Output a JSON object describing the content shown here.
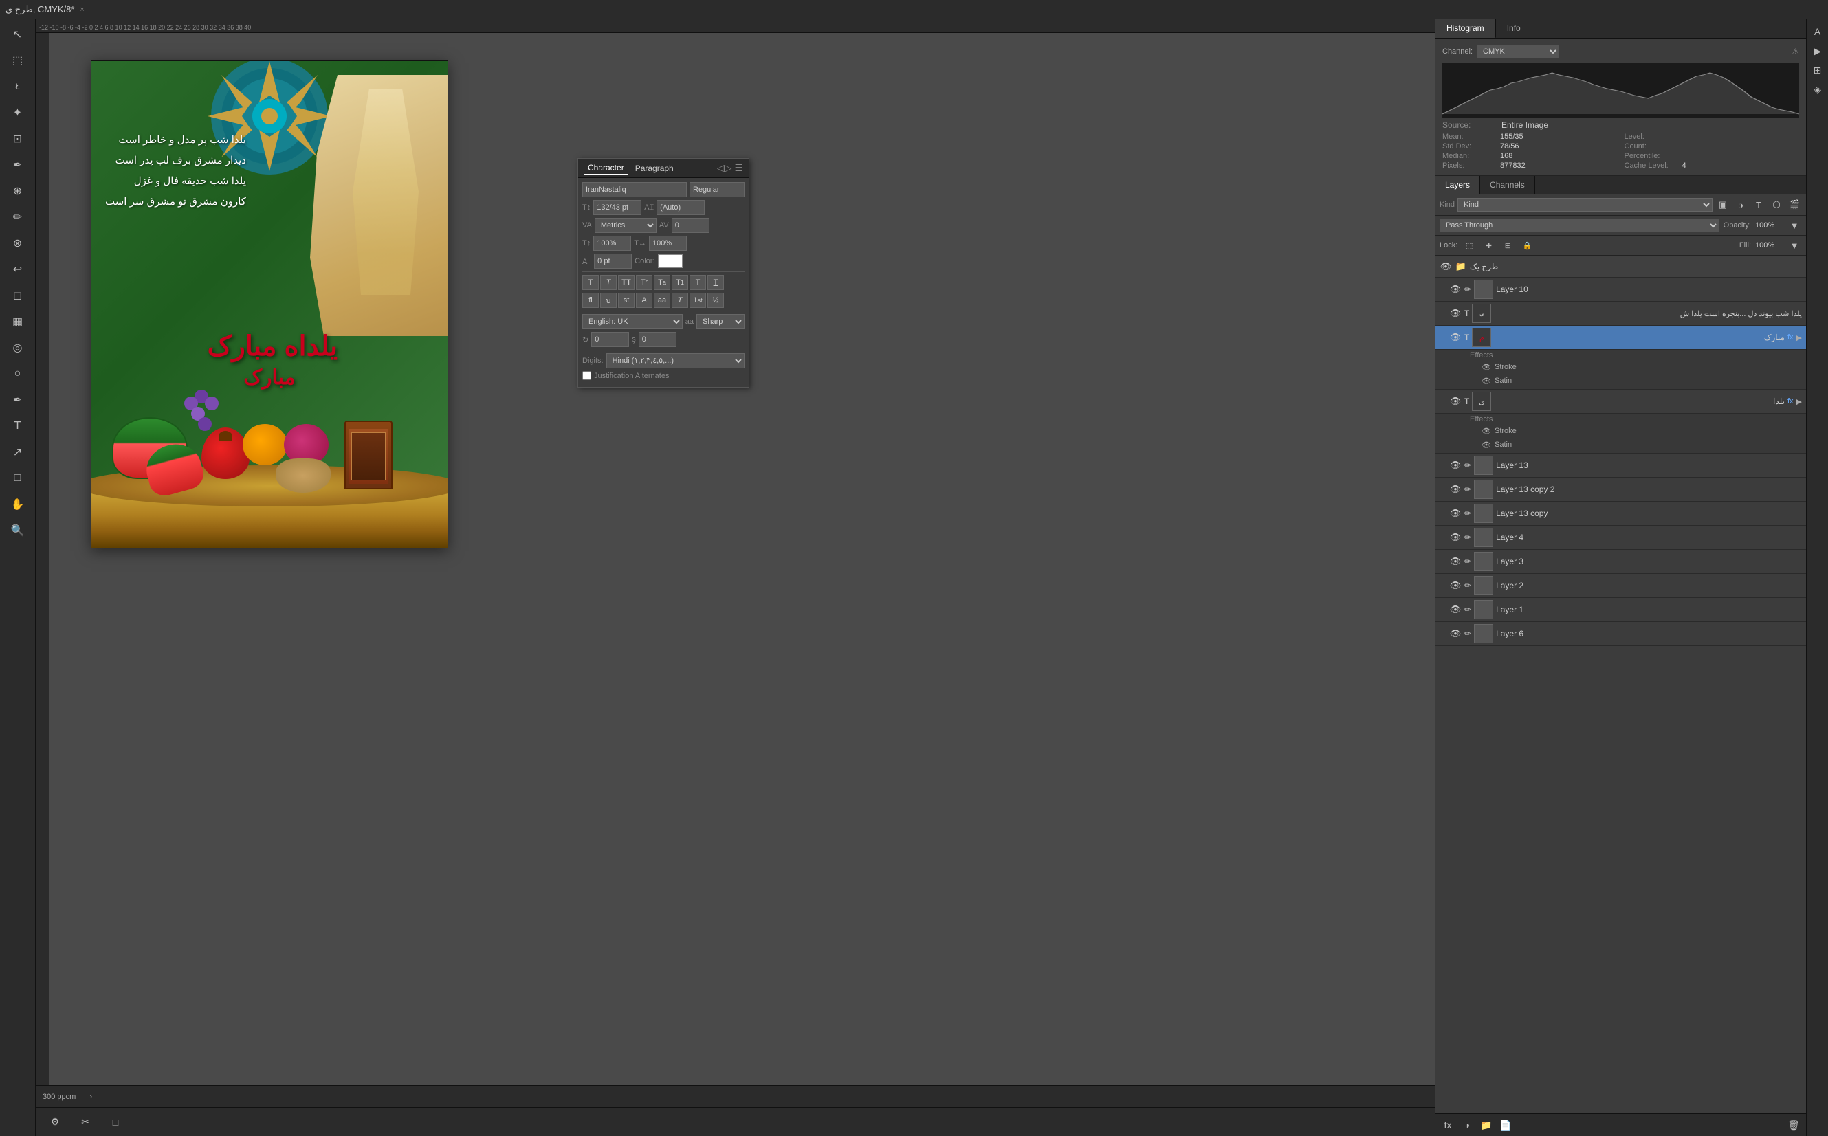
{
  "app": {
    "title": "طرح ی, CMYK/8",
    "subtitle": "*",
    "close_label": "×"
  },
  "tabs": {
    "histogram_label": "Histogram",
    "info_label": "Info"
  },
  "histogram": {
    "channel_label": "Channel:",
    "channel_value": "CMYK",
    "source_label": "Source:",
    "source_value": "Entire Image",
    "stats": {
      "mean_label": "Mean:",
      "mean_value": "155/35",
      "std_dev_label": "Std Dev:",
      "std_dev_value": "78/56",
      "median_label": "Median:",
      "median_value": "168",
      "pixels_label": "Pixels:",
      "pixels_value": "877832",
      "level_label": "Level:",
      "level_value": "",
      "count_label": "Count:",
      "count_value": "",
      "percentile_label": "Percentile:",
      "percentile_value": "",
      "cache_label": "Cache Level:",
      "cache_value": "4"
    }
  },
  "layers_panel": {
    "layers_tab": "Layers",
    "channels_tab": "Channels",
    "kind_label": "Kind",
    "blend_mode": "Pass Through",
    "opacity_label": "Opacity:",
    "opacity_value": "100%",
    "lock_label": "Lock:",
    "fill_label": "Fill:",
    "fill_value": "100%",
    "layers": [
      {
        "id": "group1",
        "name": "طرح یک",
        "type": "group",
        "visible": true,
        "selected": false,
        "indent": 0,
        "has_fx": false
      },
      {
        "id": "layer10",
        "name": "Layer 10",
        "type": "brush",
        "visible": true,
        "selected": false,
        "indent": 1,
        "has_fx": false
      },
      {
        "id": "text1",
        "name": "یلدا شب بیوند دل ...بنجره است یلدا ش",
        "type": "text",
        "visible": true,
        "selected": false,
        "indent": 1,
        "has_fx": false
      },
      {
        "id": "text2",
        "name": "مبارک",
        "type": "text",
        "visible": true,
        "selected": true,
        "indent": 1,
        "has_fx": true,
        "effects": [
          "Stroke",
          "Satin"
        ]
      },
      {
        "id": "text3",
        "name": "یلدا",
        "type": "text",
        "visible": true,
        "selected": false,
        "indent": 1,
        "has_fx": true,
        "effects": [
          "Stroke",
          "Satin"
        ]
      },
      {
        "id": "layer13",
        "name": "Layer 13",
        "type": "brush",
        "visible": true,
        "selected": false,
        "indent": 1,
        "has_fx": false
      },
      {
        "id": "layer13copy2",
        "name": "Layer 13 copy 2",
        "type": "brush",
        "visible": true,
        "selected": false,
        "indent": 1,
        "has_fx": false
      },
      {
        "id": "layer13copy",
        "name": "Layer 13 copy",
        "type": "brush",
        "visible": true,
        "selected": false,
        "indent": 1,
        "has_fx": false
      },
      {
        "id": "layer4",
        "name": "Layer 4",
        "type": "brush",
        "visible": true,
        "selected": false,
        "indent": 1,
        "has_fx": false
      },
      {
        "id": "layer3",
        "name": "Layer 3",
        "type": "brush",
        "visible": true,
        "selected": false,
        "indent": 1,
        "has_fx": false
      },
      {
        "id": "layer2",
        "name": "Layer 2",
        "type": "brush",
        "visible": true,
        "selected": false,
        "indent": 1,
        "has_fx": false
      },
      {
        "id": "layer1",
        "name": "Layer 1",
        "type": "brush",
        "visible": true,
        "selected": false,
        "indent": 1,
        "has_fx": false
      },
      {
        "id": "layer6",
        "name": "Layer 6",
        "type": "brush",
        "visible": true,
        "selected": false,
        "indent": 1,
        "has_fx": false
      }
    ],
    "bottom_buttons": [
      "fx",
      "adjustment",
      "folder",
      "page",
      "trash"
    ]
  },
  "character_panel": {
    "char_tab": "Character",
    "para_tab": "Paragraph",
    "font_name": "IranNastaliq",
    "font_style": "Regular",
    "font_size": "132/43 pt",
    "leading": "(Auto)",
    "tracking_label": "Metrics",
    "kern_value": "0",
    "scale_v": "100%",
    "scale_h": "100%",
    "baseline": "0 pt",
    "color_label": "Color:",
    "styles": [
      "T",
      "T",
      "TT",
      "Tr",
      "T",
      "T¹",
      "T",
      "⌶"
    ],
    "alt_styles": [
      "fi",
      "ꭒ",
      "st",
      "A",
      "aa",
      "T",
      "1st",
      "½"
    ],
    "language": "English: UK",
    "aa_label": "aa",
    "aa_value": "Sharp",
    "rotate_val": "0",
    "rotate_label": "ş̊",
    "slant_val": "0",
    "slant_label": "şᶯ",
    "digits_label": "Digits:",
    "digits_value": "Hindi (١,٢,٣,٤,٥,...)",
    "justification_label": "Justification Alternates"
  },
  "canvas": {
    "arabic_text_lines": [
      "یلدا شب پر مدل و خاطر است",
      "دیدار مشرق برف لب پدر است",
      "یلدا شب حدیقه فال و غزل",
      "کارون مشرق تو مشرق سر است"
    ],
    "main_title": "یلداه مبارک",
    "subtitle": "مبارک"
  },
  "status_bar": {
    "resolution": "300 ppcm",
    "arrow": "›"
  },
  "icons": {
    "eye": "👁",
    "folder": "📁",
    "text_t": "T",
    "brush": "✏",
    "fx": "fx",
    "link": "🔗",
    "trash": "🗑",
    "page": "📄",
    "adjustment": "◑",
    "search": "🔍",
    "lock": "🔒",
    "check": "✓",
    "arrow_right": "▶",
    "arrow_down": "▼",
    "chain": "⛓",
    "expand": "◁▷",
    "menu": "☰",
    "close": "×",
    "warning": "⚠"
  }
}
